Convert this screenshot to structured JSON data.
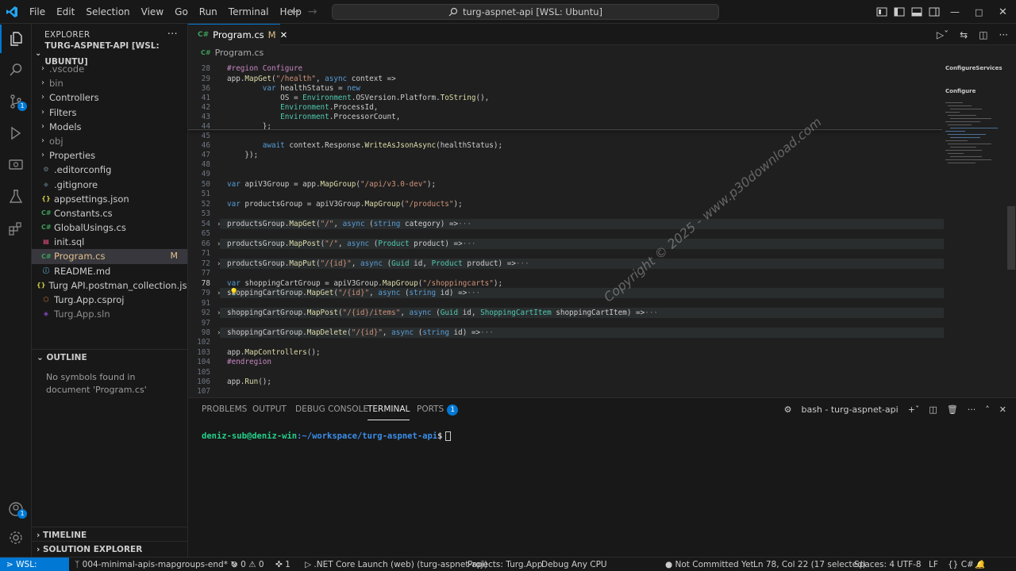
{
  "titlebar": {
    "menus": [
      "File",
      "Edit",
      "Selection",
      "View",
      "Go",
      "Run",
      "Terminal",
      "Help"
    ],
    "command_center": "turg-aspnet-api [WSL: Ubuntu]"
  },
  "activity": {
    "source_control_badge": "1",
    "account_badge": "1"
  },
  "explorer": {
    "title": "EXPLORER",
    "project": "TURG-ASPNET-API [WSL: UBUNTU]",
    "items": [
      {
        "label": ".vscode",
        "type": "folder",
        "dim": true
      },
      {
        "label": "bin",
        "type": "folder",
        "dim": true
      },
      {
        "label": "Controllers",
        "type": "folder"
      },
      {
        "label": "Filters",
        "type": "folder"
      },
      {
        "label": "Models",
        "type": "folder"
      },
      {
        "label": "obj",
        "type": "folder",
        "dim": true
      },
      {
        "label": "Properties",
        "type": "folder"
      },
      {
        "label": ".editorconfig",
        "type": "gear"
      },
      {
        "label": ".gitignore",
        "type": "git"
      },
      {
        "label": "appsettings.json",
        "type": "json"
      },
      {
        "label": "Constants.cs",
        "type": "cs"
      },
      {
        "label": "GlobalUsings.cs",
        "type": "cs"
      },
      {
        "label": "init.sql",
        "type": "sql"
      },
      {
        "label": "Program.cs",
        "type": "cs",
        "selected": true,
        "modified": "M"
      },
      {
        "label": "README.md",
        "type": "md"
      },
      {
        "label": "Turg API.postman_collection.json",
        "type": "json"
      },
      {
        "label": "Turg.App.csproj",
        "type": "proj"
      },
      {
        "label": "Turg.App.sln",
        "type": "sln",
        "dim": true
      }
    ],
    "outline_title": "OUTLINE",
    "outline_message": "No symbols found in document 'Program.cs'",
    "timeline_title": "TIMELINE",
    "solution_title": "SOLUTION EXPLORER"
  },
  "editor": {
    "tab_label": "Program.cs",
    "tab_modified": "M",
    "breadcrumb": "Program.cs",
    "minimap_labels": [
      "ConfigureServices",
      "Configure"
    ],
    "lines": [
      {
        "n": "28",
        "code": "#region Configure"
      },
      {
        "n": "29",
        "code": "app.MapGet(\"/health\", async context =>"
      },
      {
        "n": "36",
        "code": "        var healthStatus = new"
      },
      {
        "n": "41",
        "code": "            OS = Environment.OSVersion.Platform.ToString(),"
      },
      {
        "n": "42",
        "code": "            Environment.ProcessId,"
      },
      {
        "n": "43",
        "code": "            Environment.ProcessorCount,"
      },
      {
        "n": "44",
        "code": "        };"
      },
      {
        "n": "45",
        "code": ""
      },
      {
        "n": "46",
        "code": "        await context.Response.WriteAsJsonAsync(healthStatus);"
      },
      {
        "n": "47",
        "code": "    });"
      },
      {
        "n": "48",
        "code": ""
      },
      {
        "n": "49",
        "code": ""
      },
      {
        "n": "50",
        "code": "var apiV3Group = app.MapGroup(\"/api/v3.0-dev\");"
      },
      {
        "n": "51",
        "code": ""
      },
      {
        "n": "52",
        "code": "var productsGroup = apiV3Group.MapGroup(\"/products\");"
      },
      {
        "n": "53",
        "code": ""
      },
      {
        "n": "54",
        "code": "productsGroup.MapGet(\"/\", async (string category) =>···"
      },
      {
        "n": "65",
        "code": ""
      },
      {
        "n": "66",
        "code": "productsGroup.MapPost(\"/\", async (Product product) =>···"
      },
      {
        "n": "71",
        "code": ""
      },
      {
        "n": "72",
        "code": "productsGroup.MapPut(\"/{id}\", async (Guid id, Product product) =>···"
      },
      {
        "n": "77",
        "code": ""
      },
      {
        "n": "78",
        "code": "var shoppingCartGroup = apiV3Group.MapGroup(\"/shoppingcarts\");"
      },
      {
        "n": "79",
        "code": "shoppingCartGroup.MapGet(\"/{id}\", async (string id) =>···"
      },
      {
        "n": "91",
        "code": ""
      },
      {
        "n": "92",
        "code": "shoppingCartGroup.MapPost(\"/{id}/items\", async (Guid id, ShoppingCartItem shoppingCartItem) =>···"
      },
      {
        "n": "97",
        "code": ""
      },
      {
        "n": "98",
        "code": "shoppingCartGroup.MapDelete(\"/{id}\", async (string id) =>···"
      },
      {
        "n": "102",
        "code": ""
      },
      {
        "n": "103",
        "code": "app.MapControllers();"
      },
      {
        "n": "104",
        "code": "#endregion"
      },
      {
        "n": "105",
        "code": ""
      },
      {
        "n": "106",
        "code": "app.Run();"
      },
      {
        "n": "107",
        "code": ""
      }
    ]
  },
  "watermark": "Copyright © 2025 - www.p30download.com",
  "panel": {
    "tabs": [
      "PROBLEMS",
      "OUTPUT",
      "DEBUG CONSOLE",
      "TERMINAL",
      "PORTS"
    ],
    "ports_badge": "1",
    "terminal_name": "bash - turg-aspnet-api",
    "prompt_user": "deniz-sub@deniz-win",
    "prompt_path": ":~/workspace/turg-aspnet-api",
    "prompt_end": "$"
  },
  "statusbar": {
    "remote": "WSL: Ubuntu",
    "branch": "004-minimal-apis-mapgroups-end*",
    "problems": "0",
    "warnings": "0",
    "ports": "1",
    "launch": ".NET Core Launch (web) (turg-aspnet-api)",
    "projects": "Projects: Turg.App",
    "debug": "Debug Any CPU",
    "commit": "Not Committed Yet",
    "position": "Ln 78, Col 22 (17 selected)",
    "spaces": "Spaces: 4",
    "encoding": "UTF-8",
    "eol": "LF",
    "language": "C#"
  },
  "colors": {
    "accent": "#0078d4",
    "modified": "#e2c08d",
    "terminal_green": "#23d18b",
    "terminal_blue": "#3b8eea"
  }
}
